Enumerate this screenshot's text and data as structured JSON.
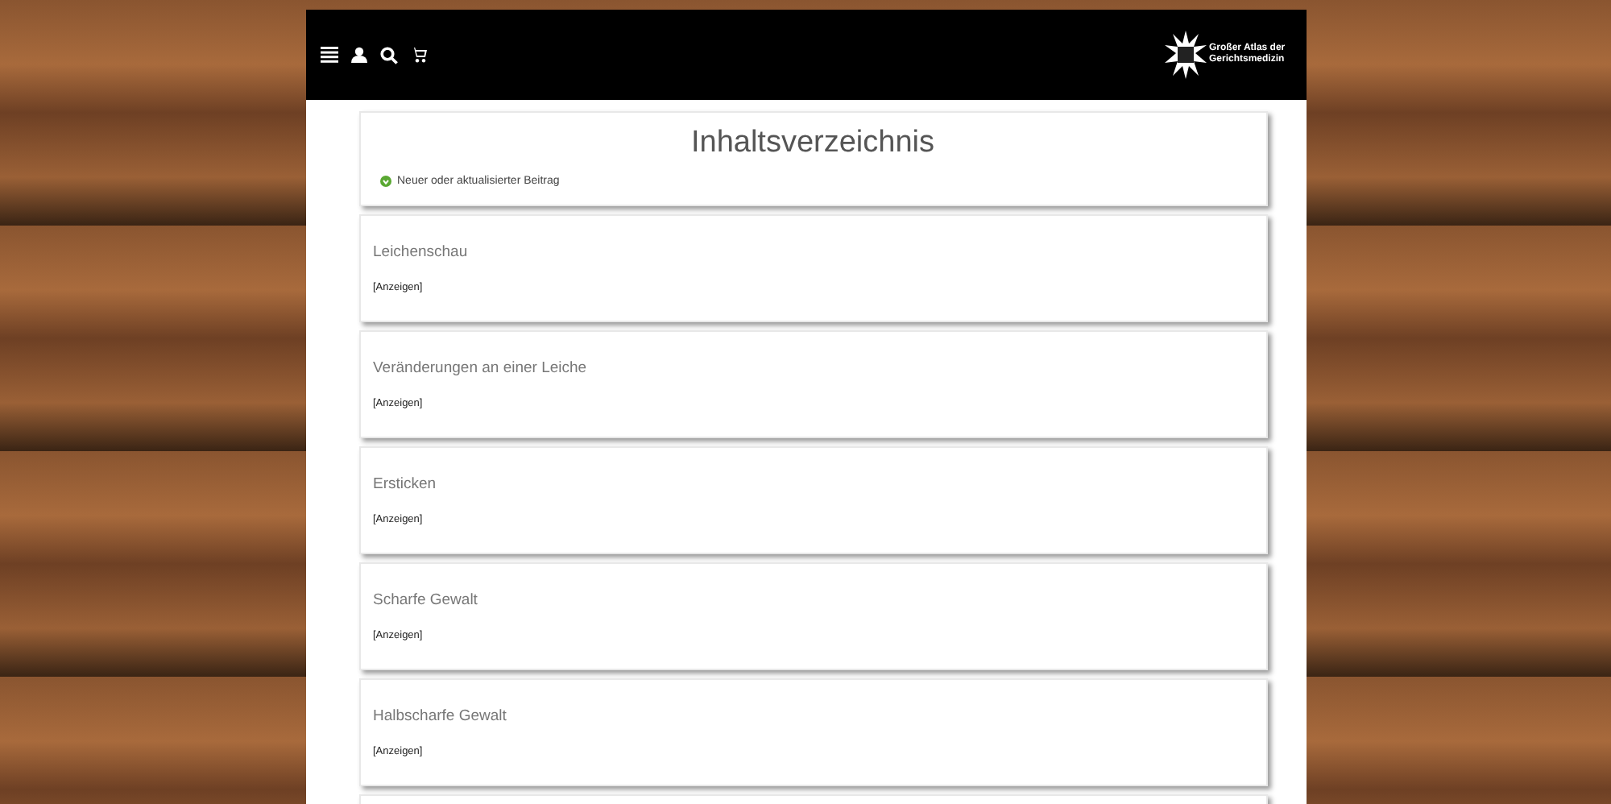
{
  "header": {
    "logo_text": "Großer Atlas der Gerichtsmedizin"
  },
  "title": "Inhaltsverzeichnis",
  "legend": {
    "label": "Neuer oder aktualisierter Beitrag"
  },
  "sections": [
    {
      "title": "Leichenschau",
      "toggle": "[Anzeigen]"
    },
    {
      "title": "Veränderungen an einer Leiche",
      "toggle": "[Anzeigen]"
    },
    {
      "title": "Ersticken",
      "toggle": "[Anzeigen]"
    },
    {
      "title": "Scharfe Gewalt",
      "toggle": "[Anzeigen]"
    },
    {
      "title": "Halbscharfe Gewalt",
      "toggle": "[Anzeigen]"
    }
  ]
}
